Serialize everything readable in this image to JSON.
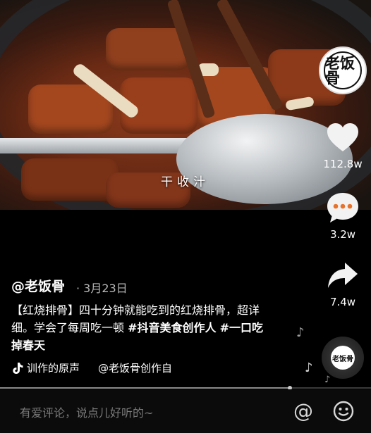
{
  "video": {
    "caption": "干收汁"
  },
  "rail": {
    "avatar_text": "老饭骨",
    "like_count": "112.8w",
    "comment_count": "3.2w",
    "share_count": "7.4w",
    "disc_text": "老饭骨"
  },
  "info": {
    "author": "@老饭骨",
    "date": "· 3月23日",
    "desc_text": "【红烧排骨】四十分钟就能吃到的红烧排骨，超详细。学会了每周吃一顿 ",
    "tag1": "#抖音美食创作人",
    "tag2": "#一口吃掉春天",
    "music_part1": "训作的原声",
    "music_part2": "@老饭骨创作自"
  },
  "progress": {
    "value": 0.78
  },
  "comment": {
    "placeholder": "有爱评论，说点儿好听的~"
  },
  "colors": {
    "background": "#000000",
    "text": "#ffffff",
    "muted": "#b8b8b8"
  },
  "icons": [
    "heart-icon",
    "comment-icon",
    "share-icon",
    "music-note-icon",
    "at-icon",
    "emoji-icon"
  ]
}
